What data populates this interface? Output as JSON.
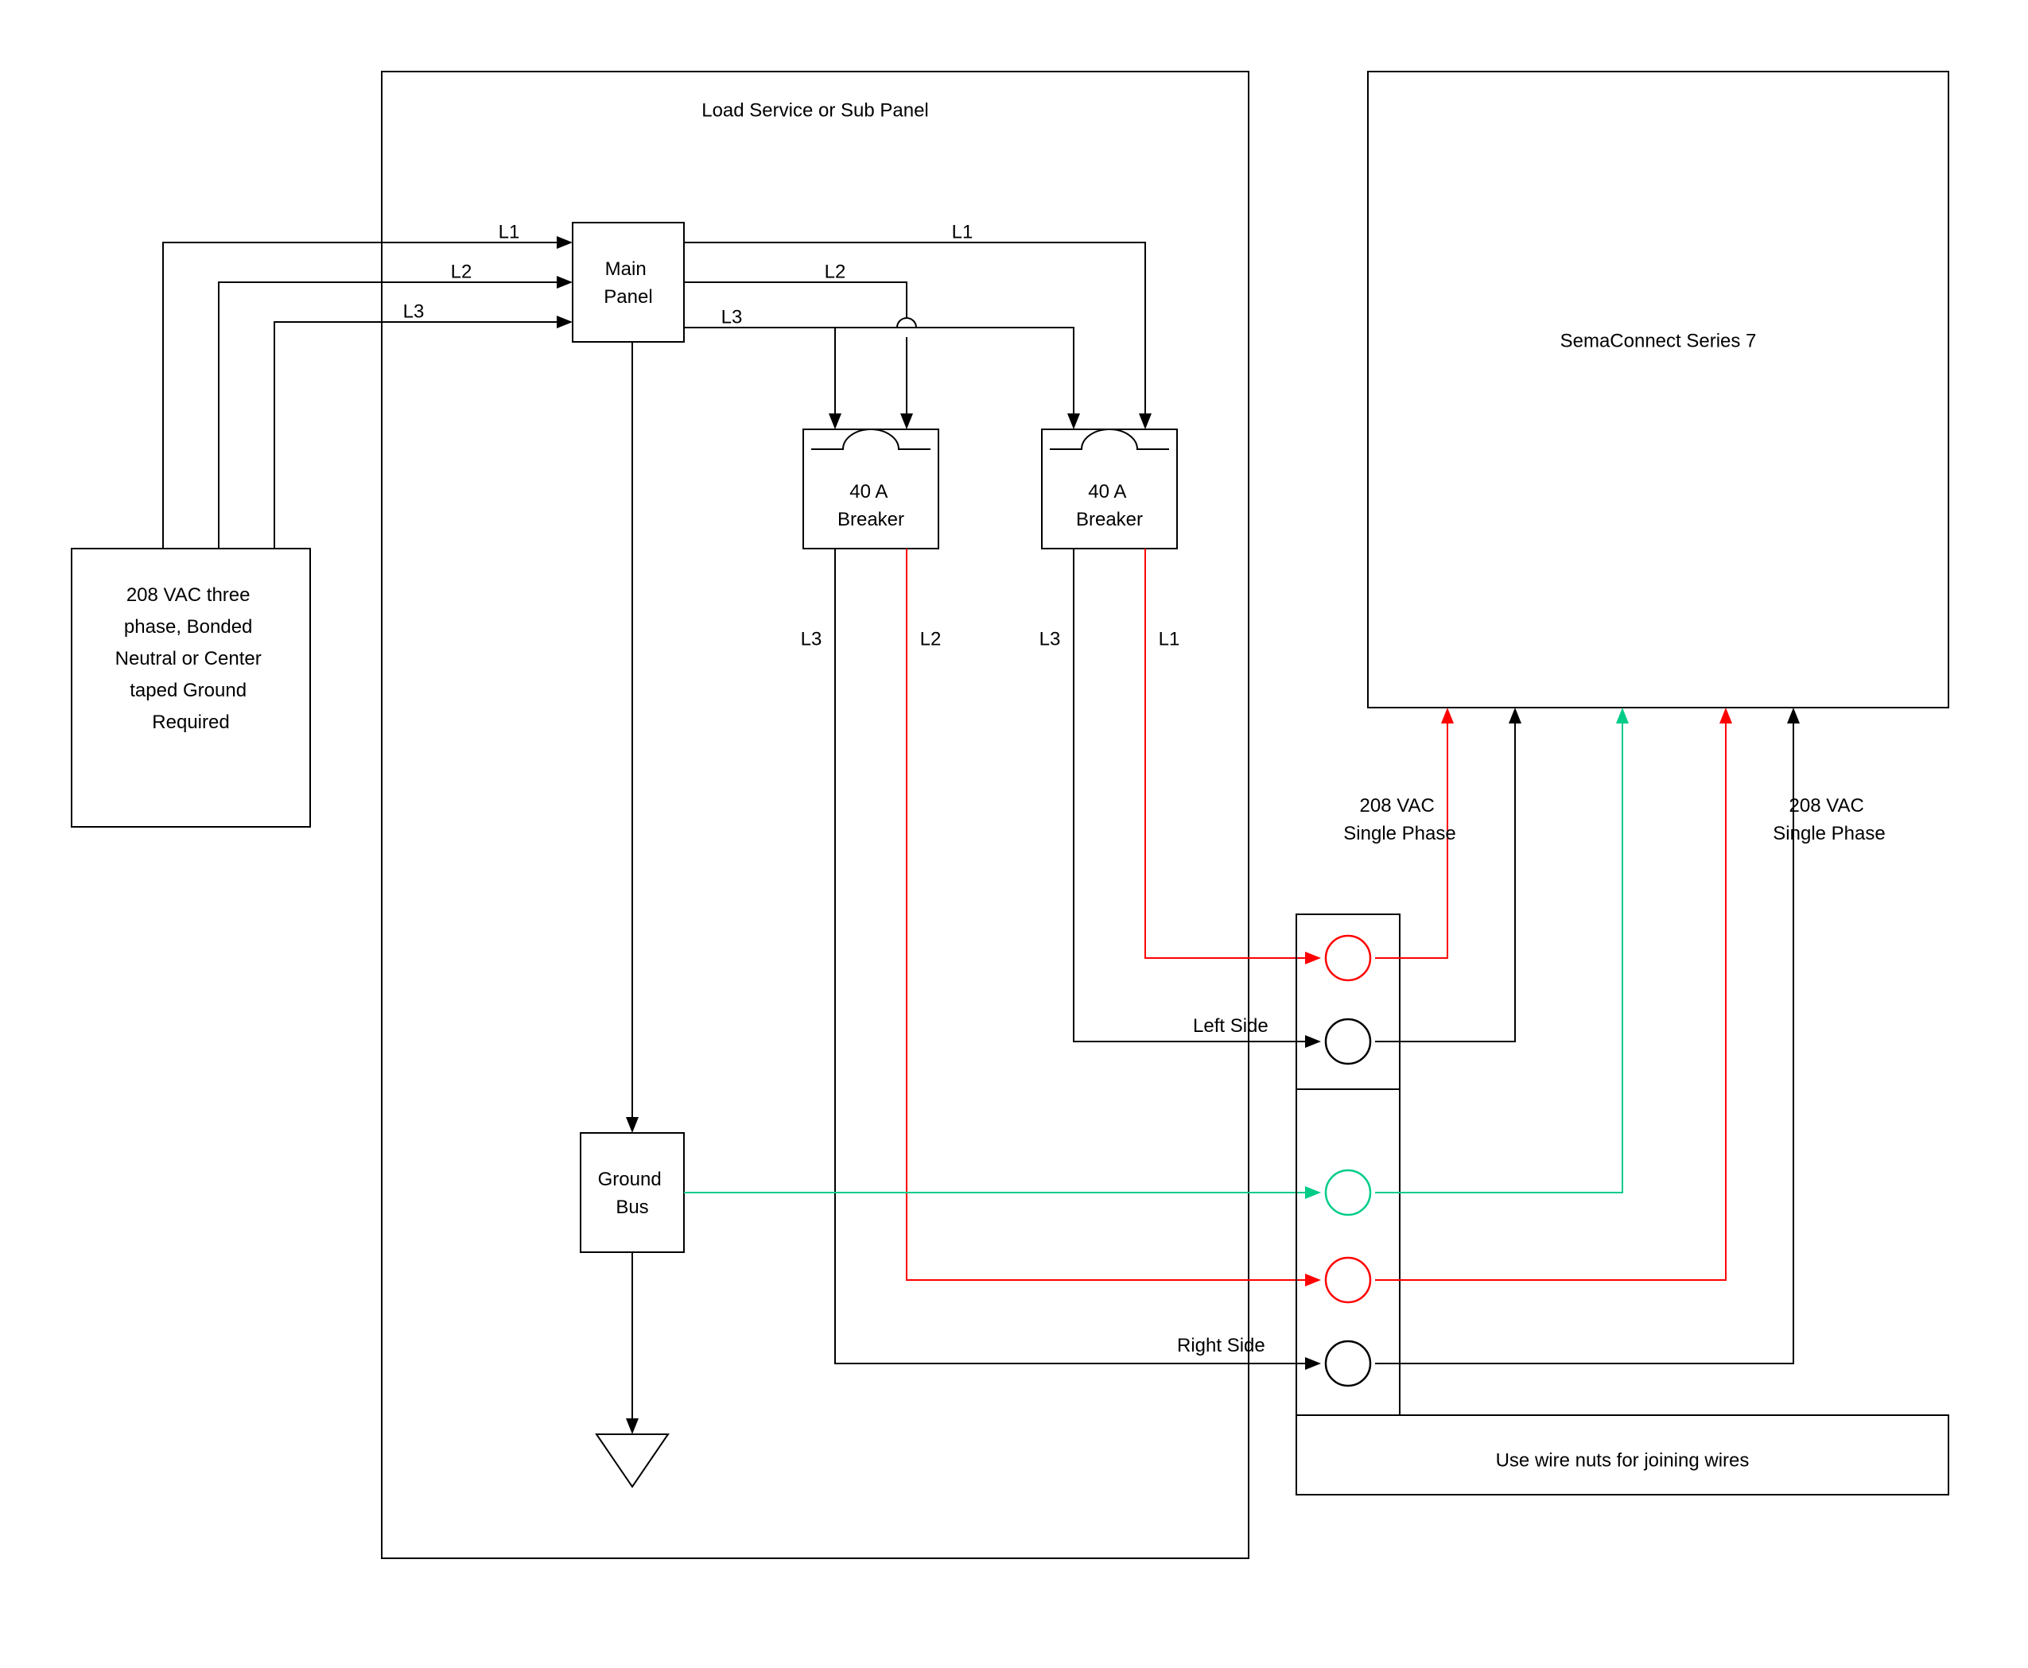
{
  "panel": {
    "title": "Load Service or Sub Panel",
    "main_panel": "Main\nPanel",
    "breaker1": "40 A\nBreaker",
    "breaker2": "40 A\nBreaker",
    "ground_bus": "Ground\nBus",
    "left_side": "Left Side",
    "right_side": "Right Side",
    "wire_nuts": "Use wire nuts for joining wires"
  },
  "source": {
    "label": "208 VAC three\nphase, Bonded\nNeutral or Center\ntaped Ground\nRequired"
  },
  "device": {
    "title": "SemaConnect Series 7",
    "input1": "208 VAC\nSingle Phase",
    "input2": "208 VAC\nSingle Phase"
  },
  "lines": {
    "L1": "L1",
    "L2": "L2",
    "L3": "L3"
  },
  "colors": {
    "red": "#ff0000",
    "green": "#00cc88",
    "black": "#000000"
  }
}
